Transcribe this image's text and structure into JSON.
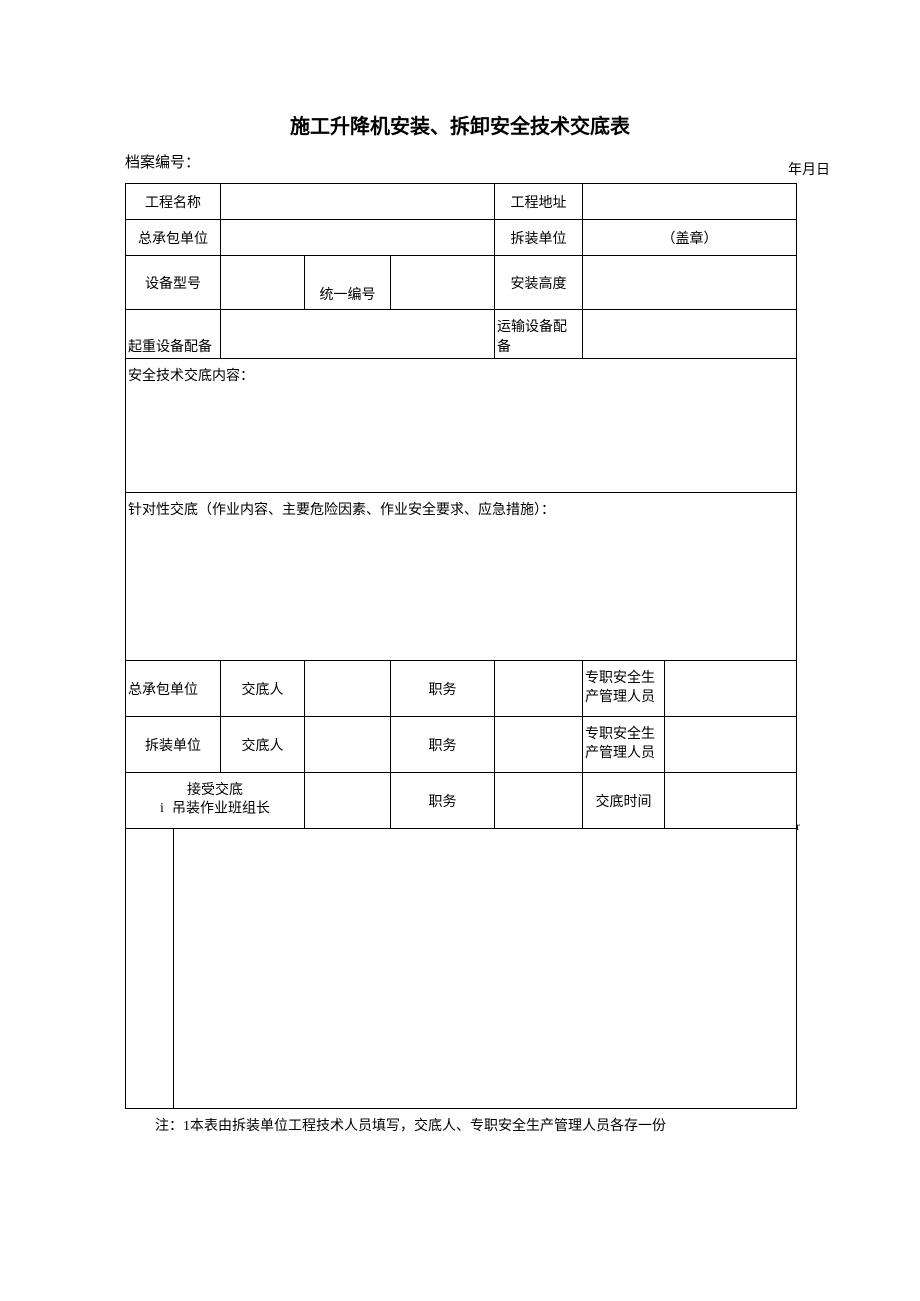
{
  "title": "施工升降机安装、拆卸安全技术交底表",
  "archive_label": "档案编号：",
  "date_label": "年月日",
  "rows": {
    "project_name": "工程名称",
    "project_addr": "工程地址",
    "general_contractor": "总承包单位",
    "dismantle_unit": "拆装单位",
    "seal": "（盖章）",
    "device_model": "设备型号",
    "unified_no": "统一编号",
    "install_height": "安装高度",
    "lifting_equip": "起重设备配备",
    "transport_equip": "运输设备配备"
  },
  "block1": "安全技术交底内容：",
  "block2": "针对性交底（作业内容、主要危险因素、作业安全要求、应急措施）：",
  "sig": {
    "gc_unit": "总承包单位",
    "disclose_person": "交底人",
    "position": "职务",
    "safety_mgr": "专职安全生产管理人员",
    "dm_unit": "拆装单位",
    "receive_line_i": "i",
    "receive_line1": "接受交底",
    "receive_line2": "吊装作业班组长",
    "disclose_time": "交底时间"
  },
  "last_row_r": "r",
  "footnote": "注：1本表由拆装单位工程技术人员填写，交底人、专职安全生产管理人员各存一份"
}
